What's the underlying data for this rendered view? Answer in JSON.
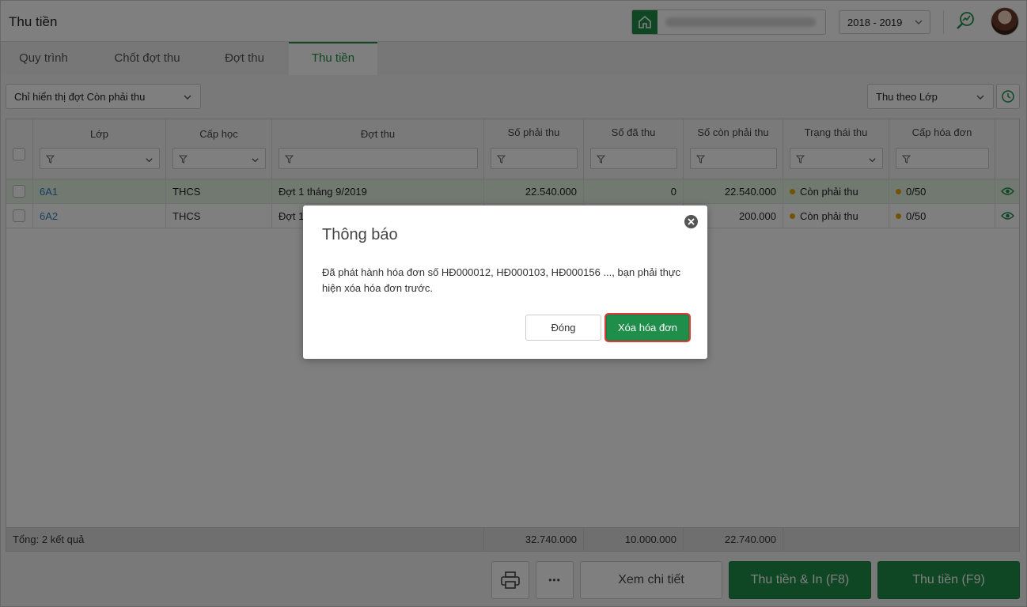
{
  "header": {
    "title": "Thu tiền",
    "school_year": "2018 - 2019"
  },
  "tabs": [
    {
      "label": "Quy trình"
    },
    {
      "label": "Chốt đợt thu"
    },
    {
      "label": "Đợt thu"
    },
    {
      "label": "Thu tiền"
    }
  ],
  "active_tab": "Thu tiền",
  "toolbar": {
    "period_filter": "Chỉ hiển thị đợt Còn phải thu",
    "group_by": "Thu theo Lớp"
  },
  "table": {
    "columns": [
      "Lớp",
      "Cấp học",
      "Đợt thu",
      "Số phải thu",
      "Số đã thu",
      "Số còn phải thu",
      "Trạng thái thu",
      "Cấp hóa đơn"
    ],
    "rows": [
      {
        "lop": "6A1",
        "cap_hoc": "THCS",
        "dot_thu": "Đợt 1 tháng 9/2019",
        "so_phai_thu": "22.540.000",
        "so_da_thu": "0",
        "so_con_phai_thu": "22.540.000",
        "trang_thai": "Còn phải thu",
        "cap_hoa_don": "0/50"
      },
      {
        "lop": "6A2",
        "cap_hoc": "THCS",
        "dot_thu": "Đợt 1",
        "so_phai_thu": "",
        "so_da_thu": "",
        "so_con_phai_thu": "200.000",
        "trang_thai": "Còn phải thu",
        "cap_hoa_don": "0/50"
      }
    ],
    "footer": {
      "summary": "Tổng: 2 kết quả",
      "so_phai_thu": "32.740.000",
      "so_da_thu": "10.000.000",
      "so_con_phai_thu": "22.740.000"
    }
  },
  "actions": {
    "more": "•••",
    "view_detail": "Xem chi tiết",
    "collect_print": "Thu tiền & In (F8)",
    "collect": "Thu tiền (F9)"
  },
  "dialog": {
    "title": "Thông báo",
    "message": "Đã phát hành hóa đơn số HĐ000012, HĐ000103, HĐ000156 ..., bạn phải thực hiện xóa hóa đơn trước.",
    "close_label": "Đóng",
    "delete_label": "Xóa hóa đơn"
  },
  "colors": {
    "brand_green": "#1e8e4a",
    "link_blue": "#2a7fc4",
    "status_dot": "#e5a900",
    "highlight_border": "#e03b3b"
  }
}
